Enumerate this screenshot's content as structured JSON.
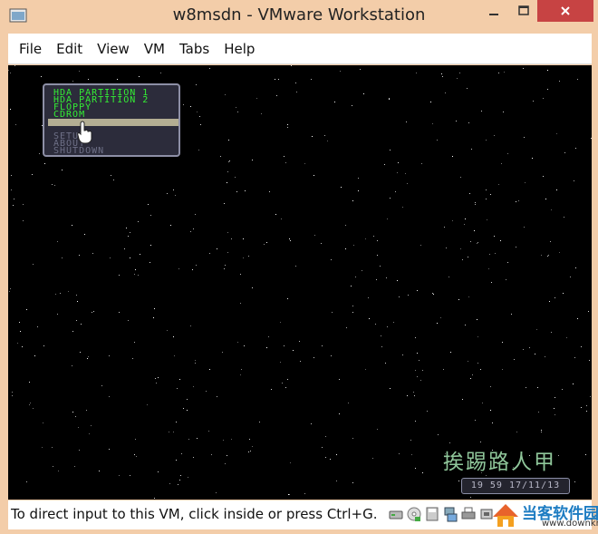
{
  "window": {
    "title": "w8msdn - VMware Workstation"
  },
  "menubar": {
    "items": [
      "File",
      "Edit",
      "View",
      "VM",
      "Tabs",
      "Help"
    ]
  },
  "console": {
    "boot_menu": {
      "items": [
        {
          "label": "HDA PARTITION 1",
          "style": "green"
        },
        {
          "label": "HDA PARTITION 2",
          "style": "green"
        },
        {
          "label": "FLOPPY",
          "style": "green"
        },
        {
          "label": "CDROM",
          "style": "green"
        },
        {
          "label": "",
          "style": "selected"
        },
        {
          "label": "SETUP",
          "style": "gray"
        },
        {
          "label": "ABOUT",
          "style": "gray"
        },
        {
          "label": "SHUTDOWN",
          "style": "gray"
        }
      ]
    },
    "watermark": "挨踢路人甲",
    "clock": "19 59 17/11/13"
  },
  "statusbar": {
    "message": "To direct input to this VM, click inside or press Ctrl+G.",
    "devices": [
      "hard-disk-icon",
      "cd-icon",
      "floppy-icon",
      "network-icon",
      "printer-icon",
      "usb-icon"
    ],
    "logo_text": "当客软件园",
    "logo_url": "www.downkr.com"
  },
  "colors": {
    "titlebar_bg": "#f3cda9",
    "close_button": "#c74343",
    "boot_green": "#34f034",
    "boot_gray": "#6f7188",
    "watermark": "#8fc69a"
  }
}
